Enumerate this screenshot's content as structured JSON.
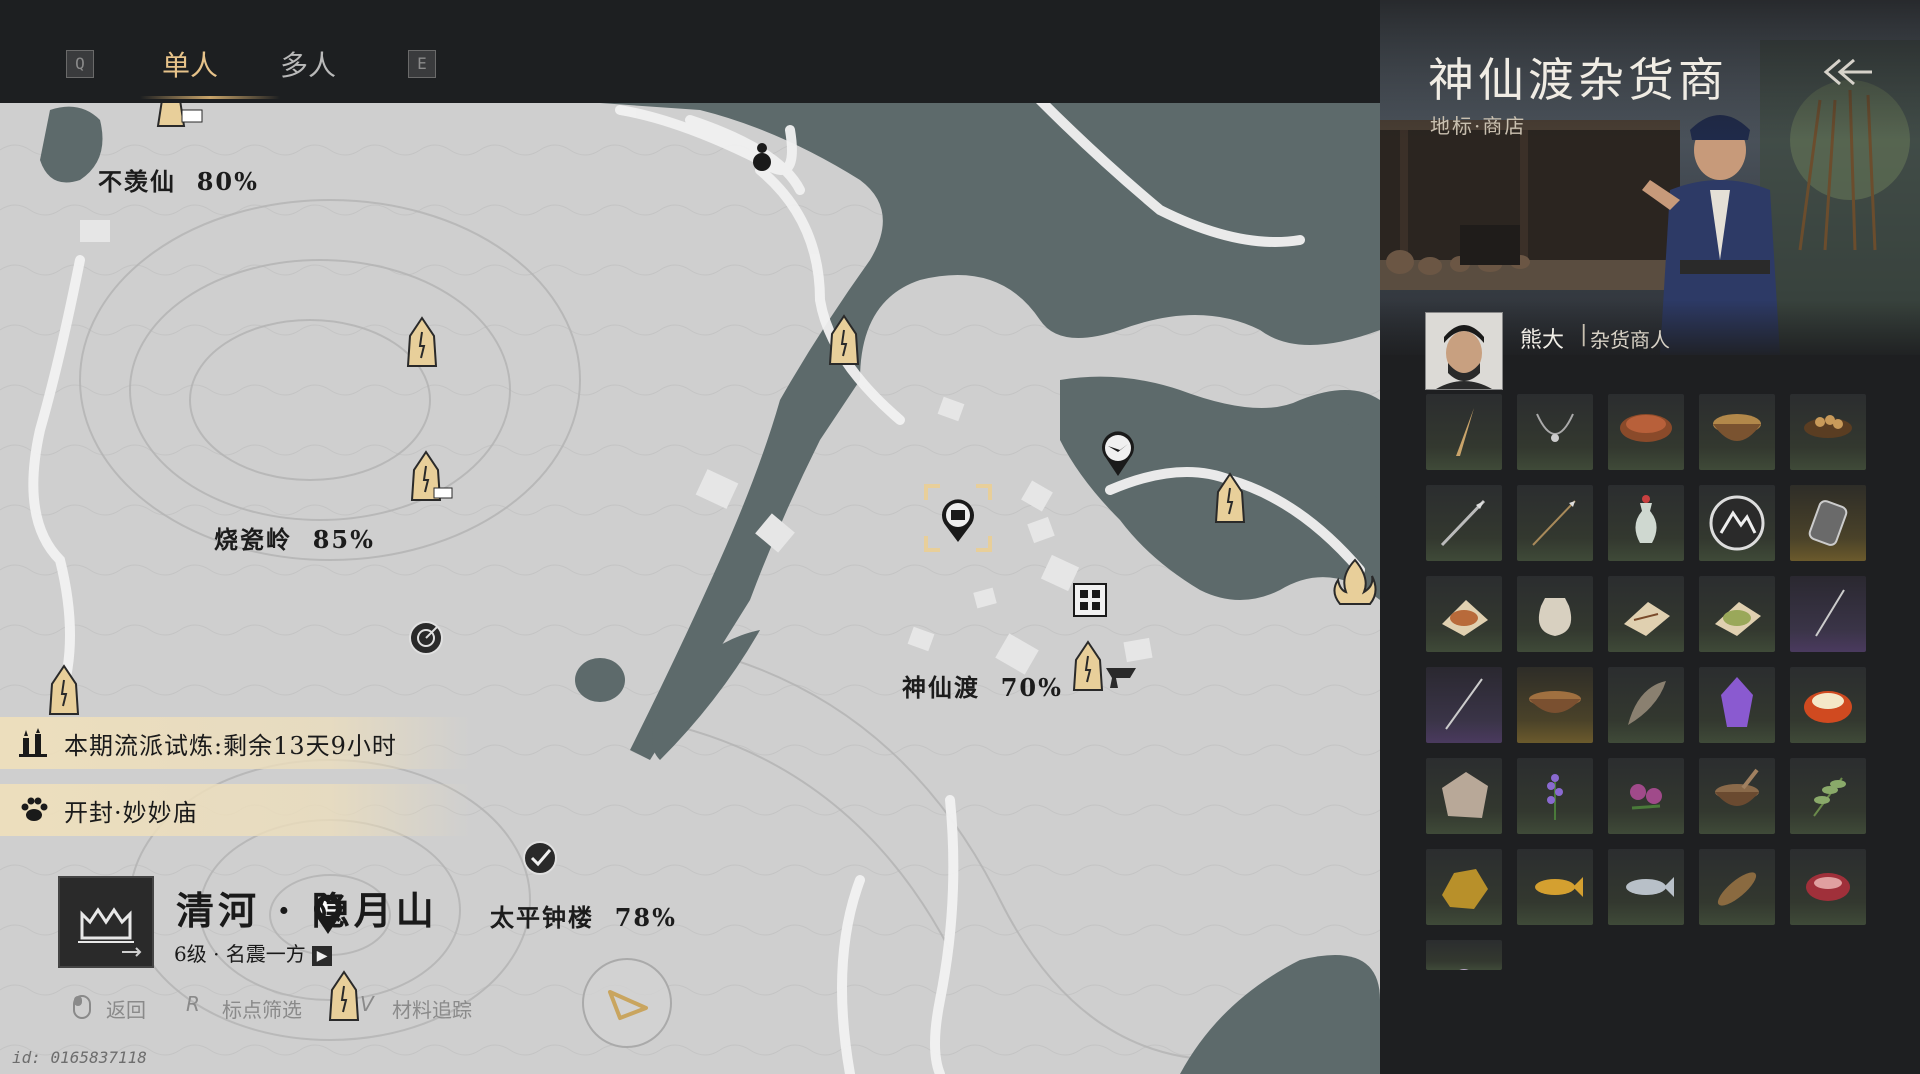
{
  "tabs": {
    "left_key": "Q",
    "right_key": "E",
    "items": [
      {
        "label": "单人",
        "active": true
      },
      {
        "label": "多人",
        "active": false
      }
    ]
  },
  "map_labels": [
    {
      "name": "不羡仙",
      "percent": "80%"
    },
    {
      "name": "烧瓷岭",
      "percent": "85%"
    },
    {
      "name": "神仙渡",
      "percent": "70%"
    },
    {
      "name": "太平钟楼",
      "percent": "78%"
    }
  ],
  "banners": [
    {
      "icon": "candles-icon",
      "text": "本期流派试炼:剩余13天9小时"
    },
    {
      "icon": "paw-icon",
      "text": "开封·妙妙庙"
    }
  ],
  "region": {
    "name": "清河 · 隐月山",
    "level": "6级 · 名震一方"
  },
  "hints": {
    "back_label": "返回",
    "filter_key": "R",
    "filter_label": "标点筛选",
    "track_key": "V",
    "track_label": "材料追踪"
  },
  "player_id": "id: 0165837118",
  "shop": {
    "title": "神仙渡杂货商",
    "subtitle": "地标·商店",
    "npc_name": "熊大",
    "npc_separator": "|",
    "npc_role": "杂货商人"
  },
  "colors": {
    "accent_gold": "#e7c38a",
    "map_paper": "#c9c9c9",
    "water": "#5a6668",
    "panel_bg": "#1e1f21"
  },
  "items": [
    {
      "icon": "fang-icon",
      "rarity": "common"
    },
    {
      "icon": "necklace-icon",
      "rarity": "common"
    },
    {
      "icon": "meat-dish-icon",
      "rarity": "common"
    },
    {
      "icon": "soup-bowl-icon",
      "rarity": "common"
    },
    {
      "icon": "nuts-plate-icon",
      "rarity": "common"
    },
    {
      "icon": "spear-icon",
      "rarity": "common"
    },
    {
      "icon": "arrow-icon",
      "rarity": "common"
    },
    {
      "icon": "vase-icon",
      "rarity": "common"
    },
    {
      "icon": "mountain-token-icon",
      "rarity": "common"
    },
    {
      "icon": "amulet-icon",
      "rarity": "gold"
    },
    {
      "icon": "spice-pile-icon",
      "rarity": "common"
    },
    {
      "icon": "cloth-sack-icon",
      "rarity": "common"
    },
    {
      "icon": "recipe-scroll-icon",
      "rarity": "common"
    },
    {
      "icon": "herb-powder-icon",
      "rarity": "common"
    },
    {
      "icon": "needle-icon",
      "rarity": "purple"
    },
    {
      "icon": "long-needle-icon",
      "rarity": "purple"
    },
    {
      "icon": "wooden-bowl-icon",
      "rarity": "gold"
    },
    {
      "icon": "feather-icon",
      "rarity": "common"
    },
    {
      "icon": "amethyst-icon",
      "rarity": "common"
    },
    {
      "icon": "egg-custard-icon",
      "rarity": "common"
    },
    {
      "icon": "hide-icon",
      "rarity": "common"
    },
    {
      "icon": "lavender-icon",
      "rarity": "common"
    },
    {
      "icon": "flower-icon",
      "rarity": "common"
    },
    {
      "icon": "mortar-icon",
      "rarity": "common"
    },
    {
      "icon": "herb-sprig-icon",
      "rarity": "common"
    },
    {
      "icon": "ore-icon",
      "rarity": "common"
    },
    {
      "icon": "carp-icon",
      "rarity": "common"
    },
    {
      "icon": "fish-icon",
      "rarity": "common"
    },
    {
      "icon": "catfish-icon",
      "rarity": "common"
    },
    {
      "icon": "raw-meat-icon",
      "rarity": "common"
    },
    {
      "icon": "shell-icon",
      "rarity": "common"
    }
  ]
}
